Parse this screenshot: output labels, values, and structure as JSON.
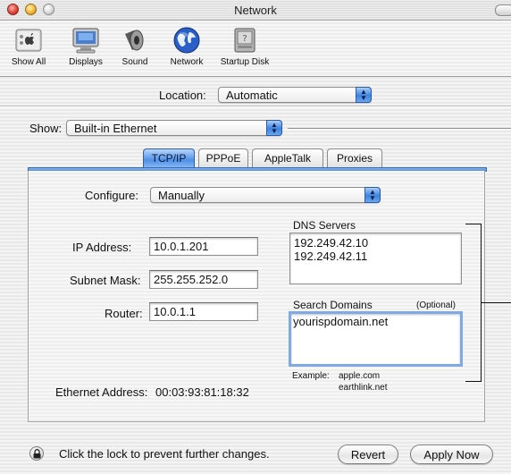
{
  "window": {
    "title": "Network"
  },
  "toolbar": {
    "items": [
      {
        "label": "Show All",
        "icon": "apple-show-all-icon"
      },
      {
        "label": "Displays",
        "icon": "display-monitor-icon"
      },
      {
        "label": "Sound",
        "icon": "speaker-icon"
      },
      {
        "label": "Network",
        "icon": "globe-icon"
      },
      {
        "label": "Startup Disk",
        "icon": "disk-icon"
      }
    ]
  },
  "location": {
    "label": "Location:",
    "value": "Automatic"
  },
  "show": {
    "label": "Show:",
    "value": "Built-in Ethernet"
  },
  "tabs": [
    {
      "label": "TCP/IP",
      "active": true
    },
    {
      "label": "PPPoE",
      "active": false
    },
    {
      "label": "AppleTalk",
      "active": false
    },
    {
      "label": "Proxies",
      "active": false
    }
  ],
  "tcpip": {
    "configure_label": "Configure:",
    "configure_value": "Manually",
    "ip_label": "IP Address:",
    "ip_value": "10.0.1.201",
    "subnet_label": "Subnet Mask:",
    "subnet_value": "255.255.252.0",
    "router_label": "Router:",
    "router_value": "10.0.1.1",
    "dns_label": "DNS Servers",
    "dns_servers": [
      "192.249.42.10",
      "192.249.42.11"
    ],
    "search_label": "Search Domains",
    "search_optional": "(Optional)",
    "search_domains": [
      "yourispdomain.net"
    ],
    "example_label": "Example:",
    "example_values": [
      "apple.com",
      "earthlink.net"
    ],
    "ethernet_label": "Ethernet Address:",
    "ethernet_value": "00:03:93:81:18:32"
  },
  "footer": {
    "lock_text": "Click the lock to prevent further changes.",
    "revert_label": "Revert",
    "apply_label": "Apply Now"
  },
  "colors": {
    "accent": "#4f90e6",
    "accent_dark": "#2f5fa8"
  }
}
